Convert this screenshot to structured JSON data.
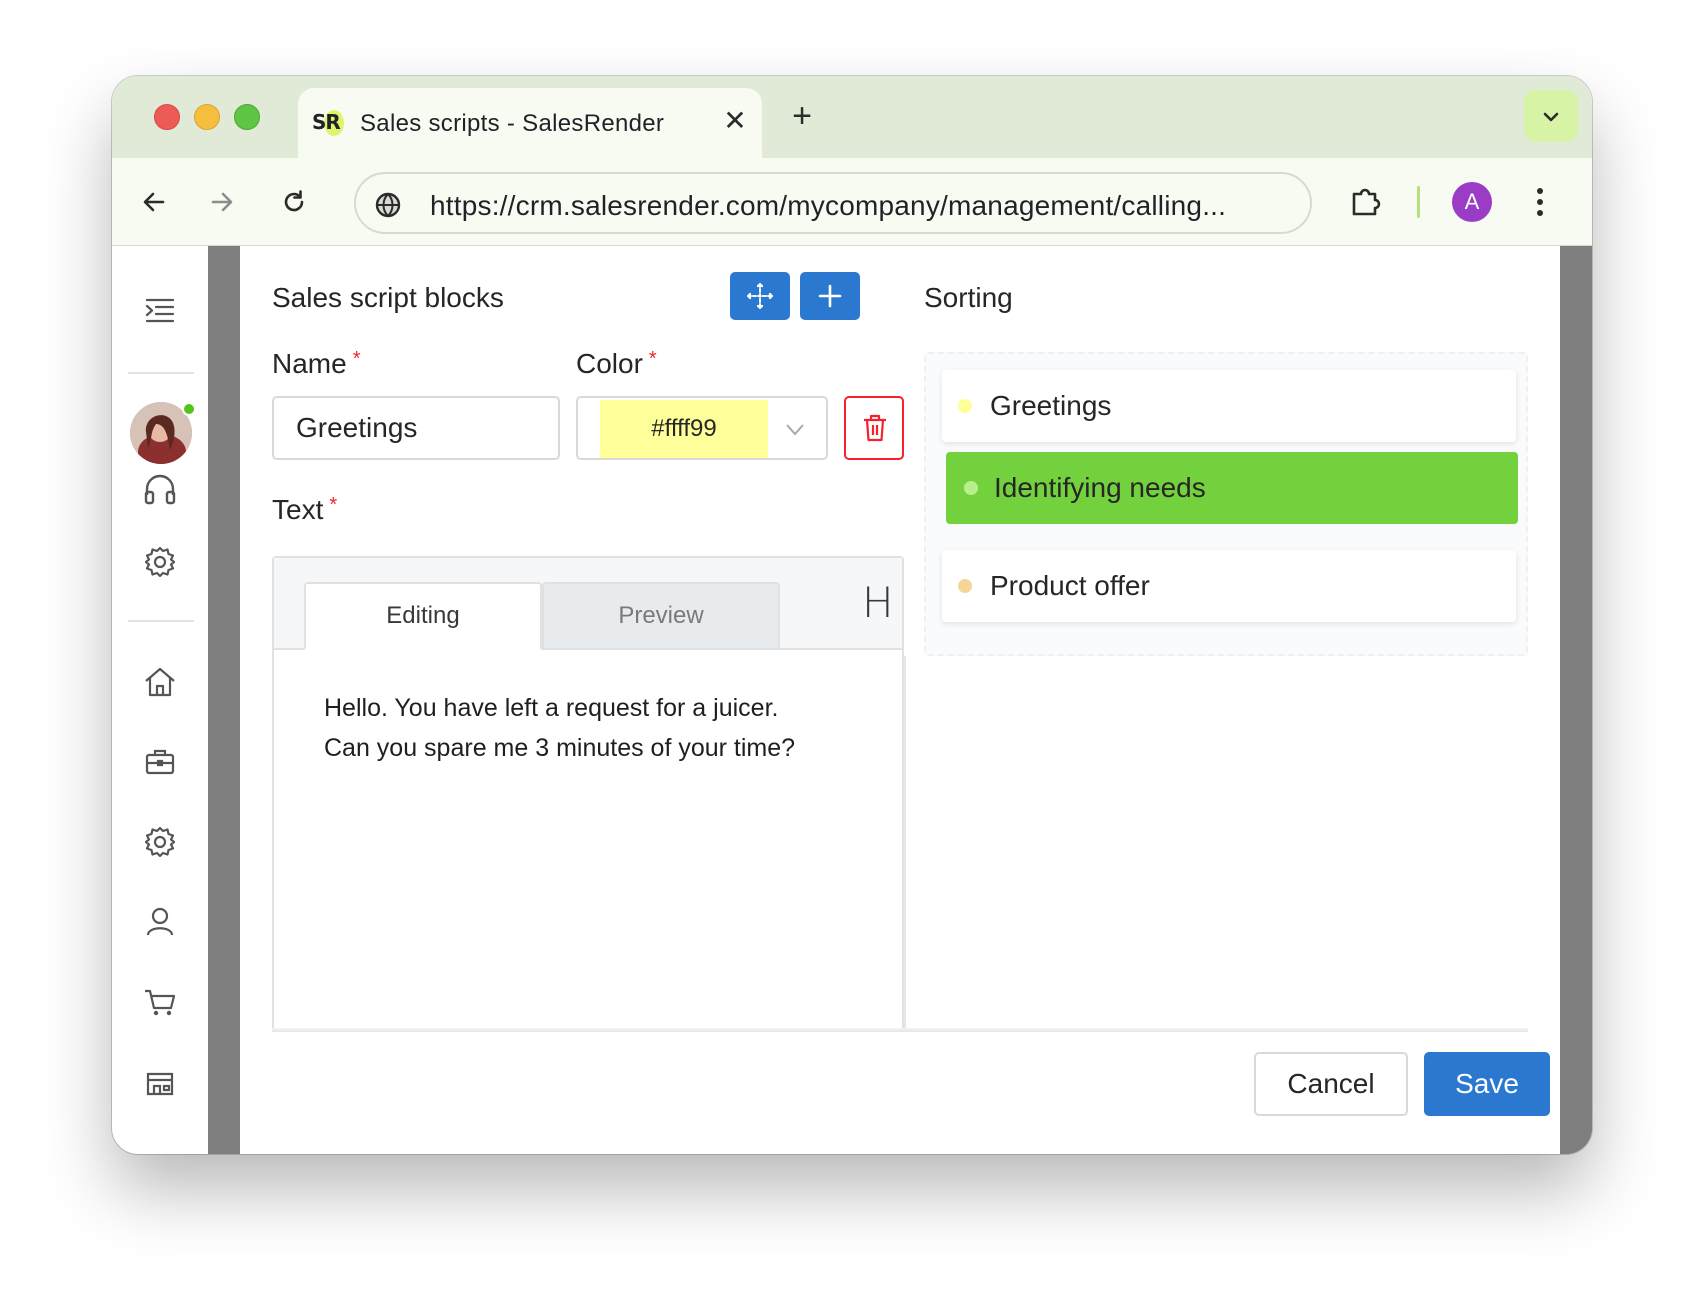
{
  "browser": {
    "tab_favicon": "SR",
    "tab_title": "Sales scripts - SalesRender",
    "tab_close": "✕",
    "new_tab": "+",
    "url": "https://crm.salesrender.com/mycompany/management/calling...",
    "profile_initial": "A"
  },
  "sidebar": {
    "icons": [
      "menu-icon",
      "avatar",
      "headset-icon",
      "gear-icon",
      "home-icon",
      "briefcase-icon",
      "gear-icon",
      "user-icon",
      "cart-icon",
      "store-icon"
    ],
    "status": "online"
  },
  "modal": {
    "title": "Sales script blocks",
    "sorting_title": "Sorting",
    "name_label": "Name",
    "color_label": "Color",
    "text_label": "Text",
    "required_mark": "*",
    "name_value": "Greetings",
    "color_value": "#ffff99",
    "editor_tabs": {
      "editing": "Editing",
      "preview": "Preview",
      "heading": "H"
    },
    "editor_lines": [
      "Hello. You have left a request for a juicer.",
      "Can you spare me 3 minutes of your time?"
    ],
    "sorting_items": [
      {
        "label": "Greetings",
        "color": "#ffff99",
        "active": false
      },
      {
        "label": "Identifying needs",
        "color": "#73d13d",
        "active": true
      },
      {
        "label": "Product offer",
        "color": "#f6d598",
        "active": false
      }
    ],
    "cancel_label": "Cancel",
    "save_label": "Save"
  },
  "colors": {
    "primary": "#2b78d0",
    "danger": "#f5222d",
    "active_item": "#73d13d"
  }
}
